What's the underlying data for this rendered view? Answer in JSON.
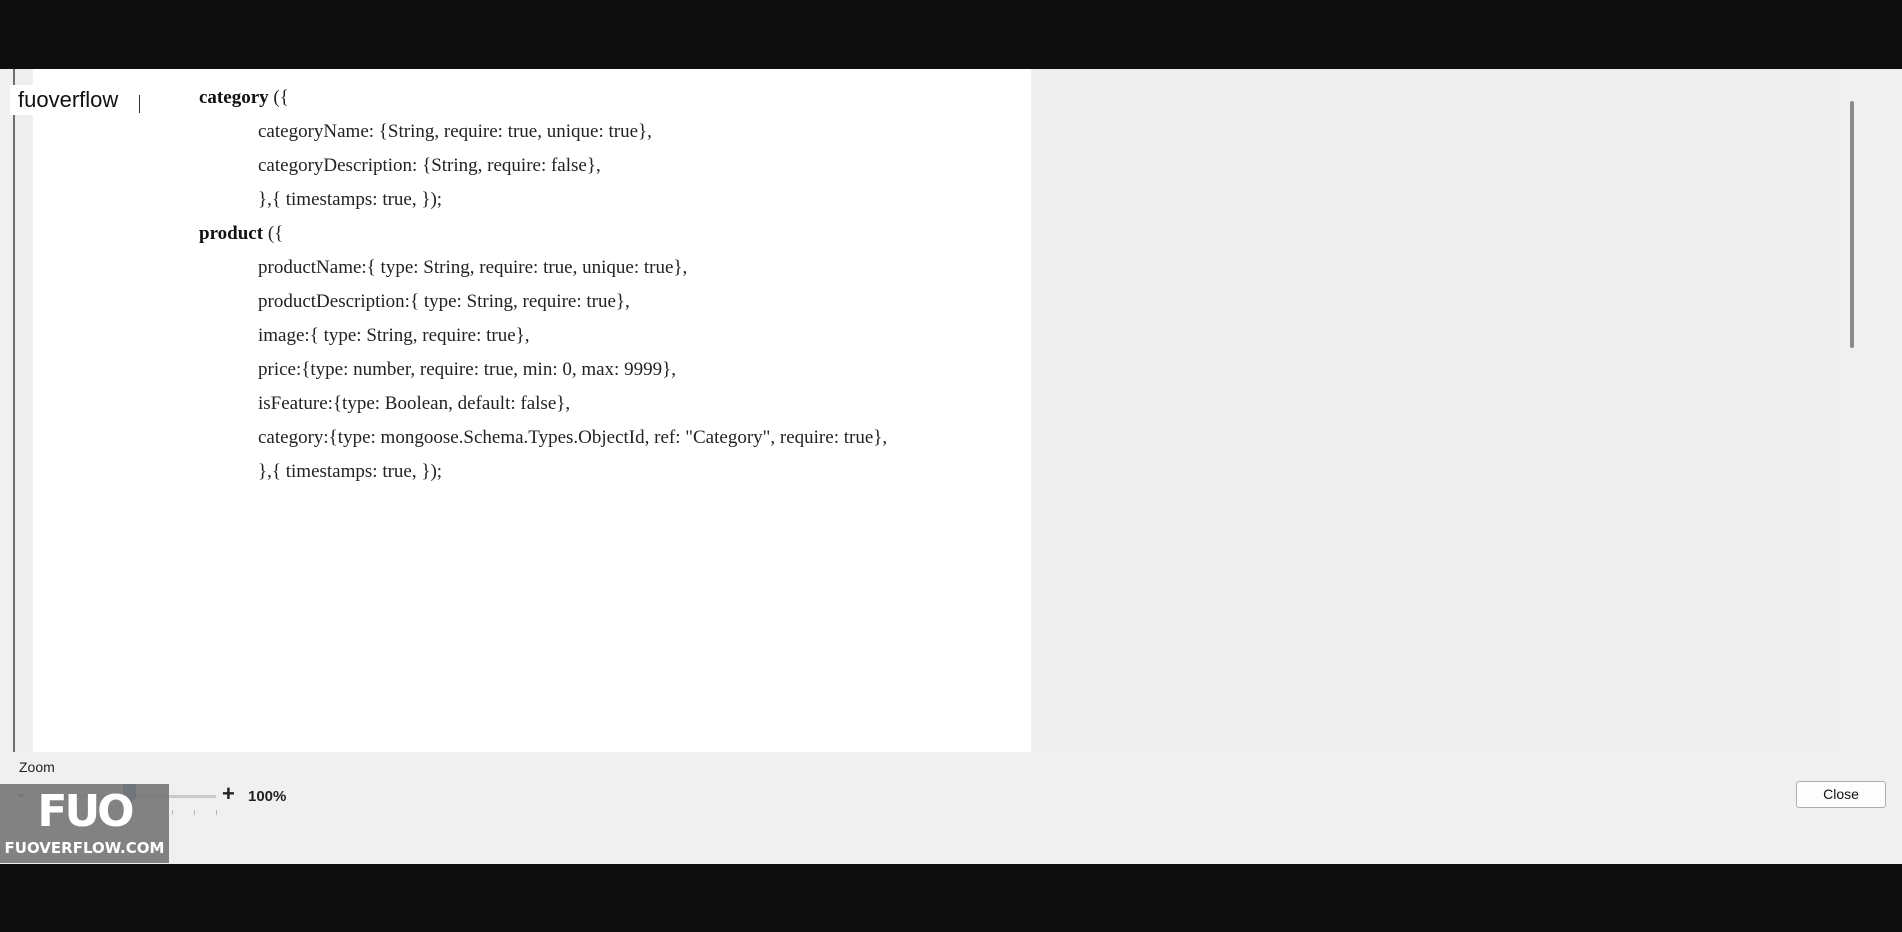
{
  "watermark": {
    "text": "fuoverflow"
  },
  "document": {
    "lines": [
      {
        "keyword": "category",
        "text": " ({",
        "indent": 0
      },
      {
        "keyword": "",
        "text": "categoryName: {String, require: true, unique: true},",
        "indent": 1
      },
      {
        "keyword": "",
        "text": "categoryDescription: {String, require: false},",
        "indent": 1
      },
      {
        "keyword": "",
        "text": "},{ timestamps: true, });",
        "indent": 1
      },
      {
        "keyword": "product",
        "text": " ({",
        "indent": 0
      },
      {
        "keyword": "",
        "text": "productName:{ type: String, require: true, unique: true},",
        "indent": 1
      },
      {
        "keyword": "",
        "text": "productDescription:{ type: String, require: true},",
        "indent": 1
      },
      {
        "keyword": "",
        "text": "image:{ type: String, require: true},",
        "indent": 1
      },
      {
        "keyword": "",
        "text": "price:{type: number, require: true, min: 0, max: 9999},",
        "indent": 1
      },
      {
        "keyword": "",
        "text": "isFeature:{type: Boolean, default: false},",
        "indent": 1
      },
      {
        "keyword": "",
        "text": "category:{type: mongoose.Schema.Types.ObjectId, ref: \"Category\", require: true},",
        "indent": 1
      },
      {
        "keyword": "",
        "text": "},{ timestamps: true, });",
        "indent": 1
      }
    ]
  },
  "zoom": {
    "label": "Zoom",
    "minus": "-",
    "plus": "+",
    "value": "100%",
    "level_fraction": 0.5
  },
  "buttons": {
    "close": "Close"
  },
  "logo": {
    "mark": "FUO",
    "site": "FUOVERFLOW.COM"
  },
  "colors": {
    "slider_thumb": "#1f5fa0",
    "page": "#ffffff",
    "background": "#f0f0f0"
  }
}
